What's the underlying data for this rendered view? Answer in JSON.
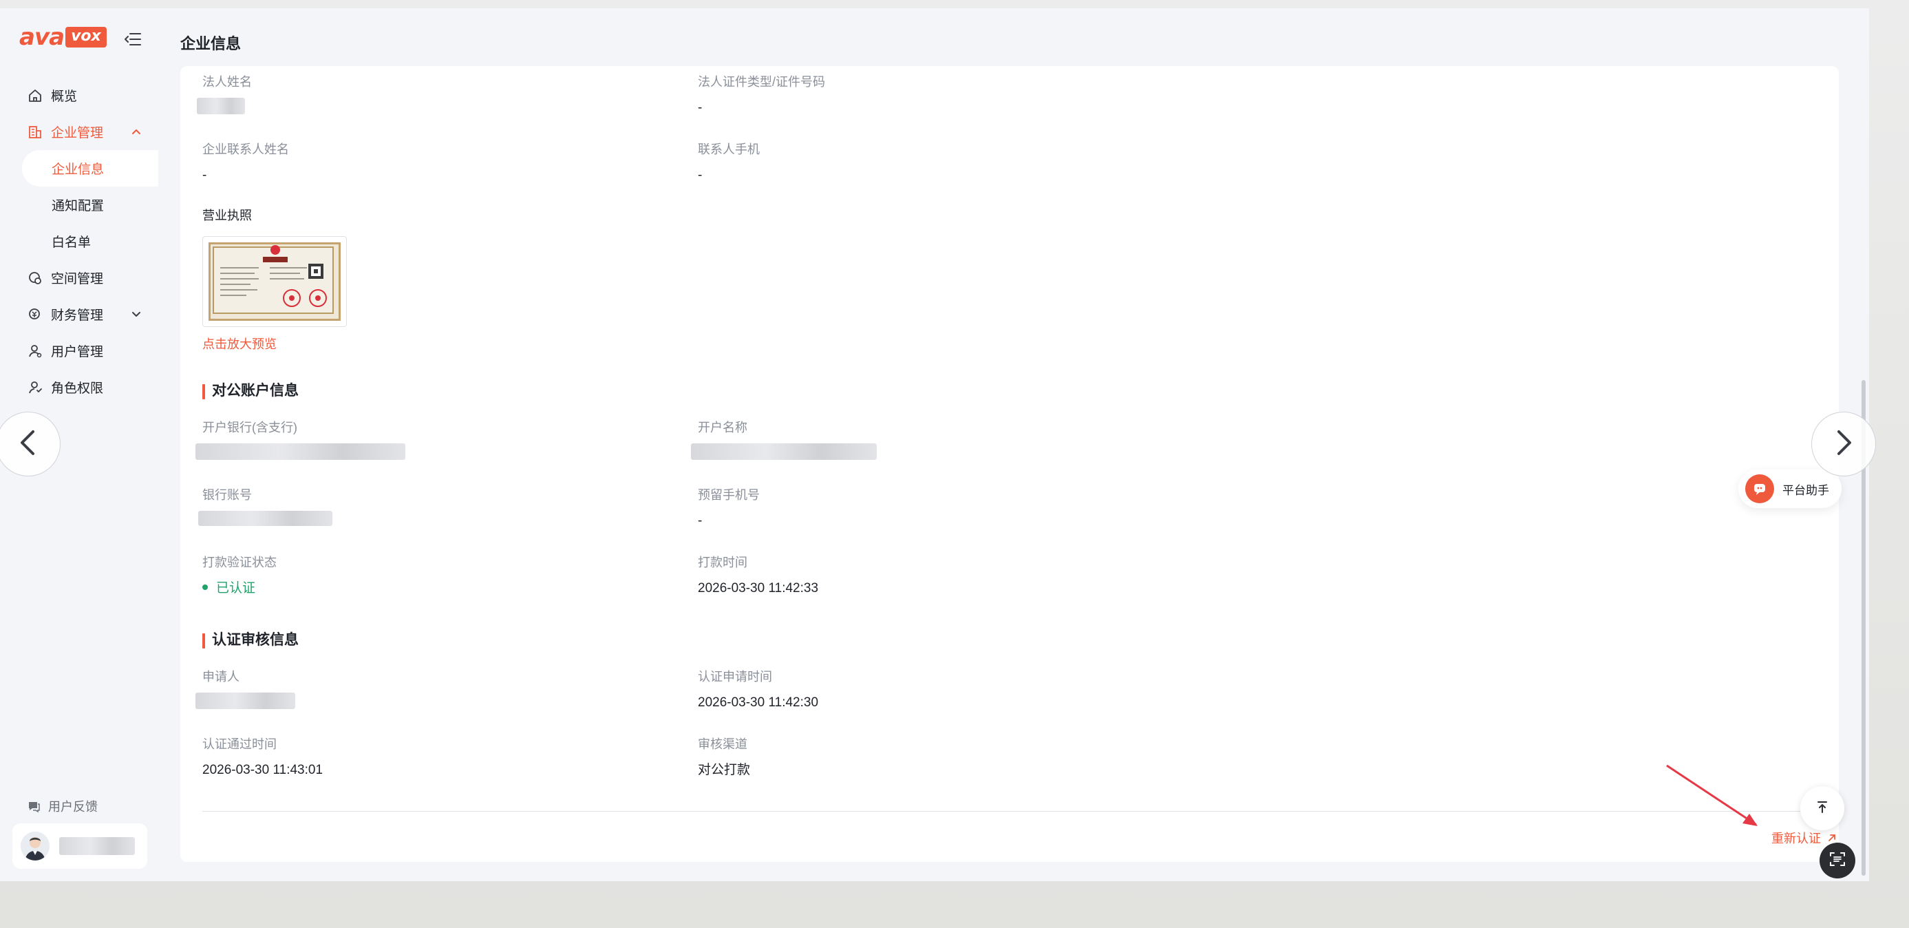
{
  "sidebar": {
    "logo_ava": "ava",
    "logo_vox": "vox",
    "items": [
      {
        "label": "概览",
        "icon": "home-icon"
      },
      {
        "label": "企业管理",
        "icon": "building-icon",
        "expanded": true
      },
      {
        "label": "企业信息",
        "sub": true,
        "active": true
      },
      {
        "label": "通知配置",
        "sub": true
      },
      {
        "label": "白名单",
        "sub": true
      },
      {
        "label": "空间管理",
        "icon": "space-icon"
      },
      {
        "label": "财务管理",
        "icon": "finance-icon",
        "expanded": false
      },
      {
        "label": "用户管理",
        "icon": "user-icon"
      },
      {
        "label": "角色权限",
        "icon": "role-icon"
      }
    ],
    "feedback_label": "用户反馈"
  },
  "page": {
    "title": "企业信息"
  },
  "fields": {
    "legal_name_label": "法人姓名",
    "legal_id_label": "法人证件类型/证件号码",
    "legal_id_value": "-",
    "contact_name_label": "企业联系人姓名",
    "contact_name_value": "-",
    "contact_phone_label": "联系人手机",
    "contact_phone_value": "-",
    "license_label": "营业执照",
    "preview_link": "点击放大预览"
  },
  "account_section": {
    "title": "对公账户信息",
    "bank_label": "开户银行(含支行)",
    "account_name_label": "开户名称",
    "account_no_label": "银行账号",
    "reserved_phone_label": "预留手机号",
    "reserved_phone_value": "-",
    "verify_status_label": "打款验证状态",
    "verify_status_value": "已认证",
    "pay_time_label": "打款时间",
    "pay_time_value": "2026-03-30 11:42:33"
  },
  "audit_section": {
    "title": "认证审核信息",
    "applicant_label": "申请人",
    "apply_time_label": "认证申请时间",
    "apply_time_value": "2026-03-30 11:42:30",
    "pass_time_label": "认证通过时间",
    "pass_time_value": "2026-03-30 11:43:01",
    "channel_label": "审核渠道",
    "channel_value": "对公打款"
  },
  "actions": {
    "recertify": "重新认证"
  },
  "assistant": {
    "label": "平台助手"
  },
  "colors": {
    "brand": "#f05a3c",
    "success": "#1fa36b",
    "text": "#1f2329",
    "muted": "#8a8f99"
  }
}
